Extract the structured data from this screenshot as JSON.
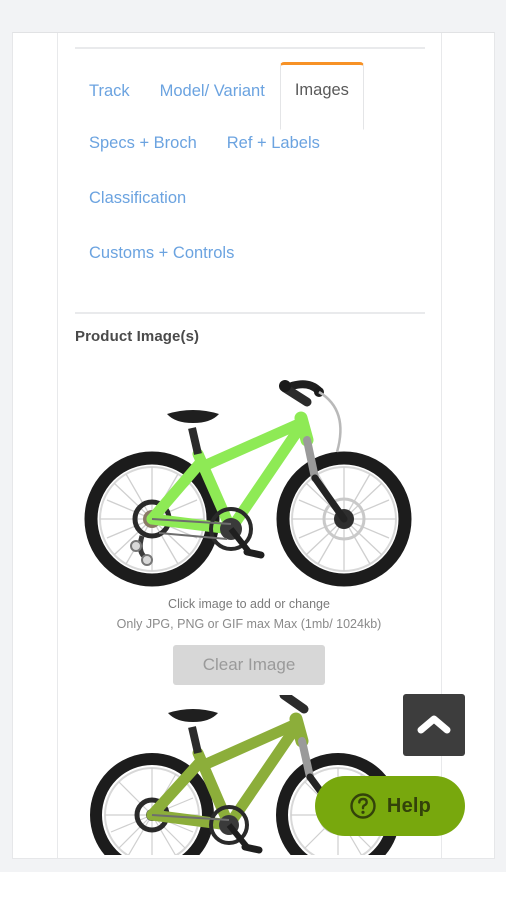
{
  "window": {
    "background_color": "#f2f3f5",
    "card_background": "#ffffff"
  },
  "colors": {
    "tab_link": "#6ba3e0",
    "tab_active_text": "#5a5a5a",
    "tab_active_accent": "#f79226",
    "heading": "#4a4a4a",
    "muted_text": "#7b7b7b",
    "clear_button_bg": "#d7d7d7",
    "clear_button_text": "#9a9a9a",
    "help_green": "#78a80d",
    "help_text": "#33420a",
    "scroll_top_bg": "#3d3d3d",
    "bike_primary_green": "#8eea55",
    "bike_secondary_green": "#8cae3a",
    "divider": "#e9eaec"
  },
  "tabs": {
    "rows": [
      [
        {
          "label": "Track",
          "active": false,
          "name": "tab-track"
        },
        {
          "label": "Model/ Variant",
          "active": false,
          "name": "tab-model-variant"
        },
        {
          "label": "Images",
          "active": true,
          "name": "tab-images"
        }
      ],
      [
        {
          "label": "Specs + Broch",
          "active": false,
          "name": "tab-specs-broch"
        },
        {
          "label": "Ref + Labels",
          "active": false,
          "name": "tab-ref-labels"
        }
      ],
      [
        {
          "label": "Classification",
          "active": false,
          "name": "tab-classification"
        }
      ],
      [
        {
          "label": "Customs + Controls",
          "active": false,
          "name": "tab-customs-controls"
        }
      ]
    ]
  },
  "section": {
    "title": "Product Image(s)"
  },
  "image_upload": {
    "caption": "Click image to add or change",
    "hint": "Only JPG, PNG or GIF max Max (1mb/ 1024kb)",
    "clear_button_label": "Clear Image",
    "primary_image_alt": "green mountain bike side view",
    "secondary_image_alt": "olive green mountain bike side view"
  },
  "floating": {
    "scroll_top_icon": "chevron-up-icon",
    "help_icon": "question-circle-icon",
    "help_label": "Help"
  }
}
